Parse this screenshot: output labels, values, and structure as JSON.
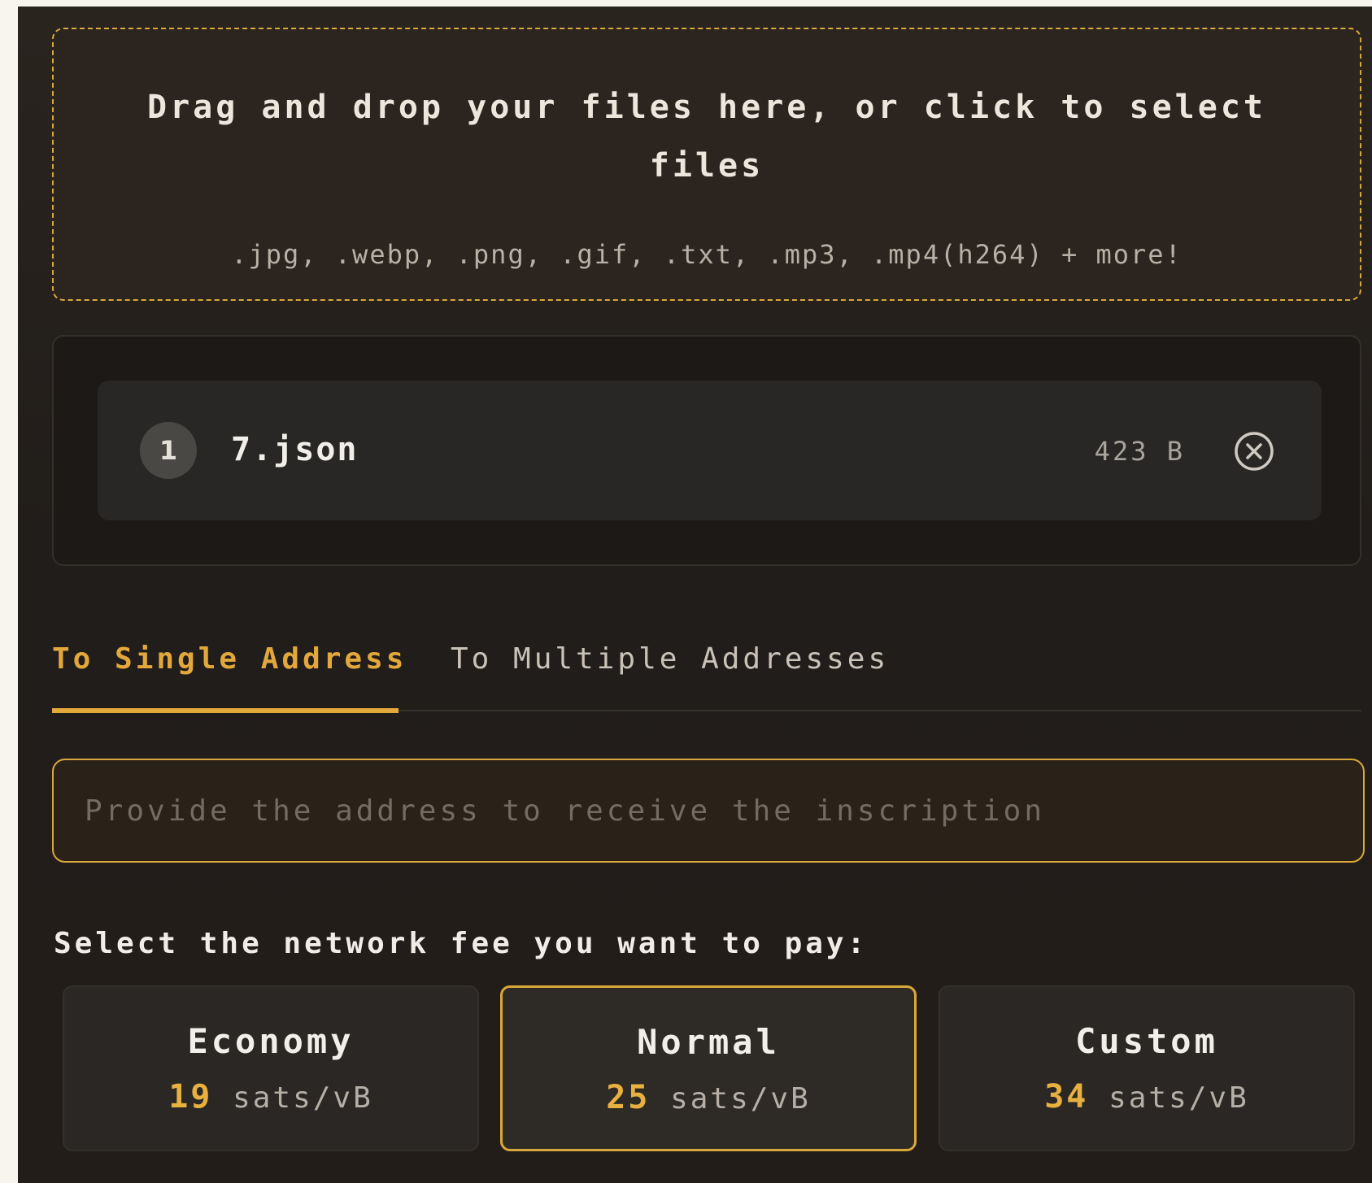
{
  "dropzone": {
    "title": "Drag and drop your files here, or click to select files",
    "formats": ".jpg, .webp, .png, .gif, .txt, .mp3, .mp4(h264) + more!"
  },
  "files": [
    {
      "index": "1",
      "name": "7.json",
      "size": "423 B",
      "remove_icon": "circle-x-icon"
    }
  ],
  "tabs": [
    {
      "label": "To Single Address",
      "active": true
    },
    {
      "label": "To Multiple Addresses",
      "active": false
    }
  ],
  "address": {
    "value": "",
    "placeholder": "Provide the address to receive the inscription"
  },
  "fees": {
    "label": "Select the network fee you want to pay:",
    "options": [
      {
        "name": "Economy",
        "value": "19",
        "unit": "sats/vB",
        "selected": false
      },
      {
        "name": "Normal",
        "value": "25",
        "unit": "sats/vB",
        "selected": true
      },
      {
        "name": "Custom",
        "value": "34",
        "unit": "sats/vB",
        "selected": false
      }
    ]
  },
  "colors": {
    "accent": "#e3a83c",
    "panel_background": "#221d19",
    "page_background": "#f8f5ef"
  }
}
